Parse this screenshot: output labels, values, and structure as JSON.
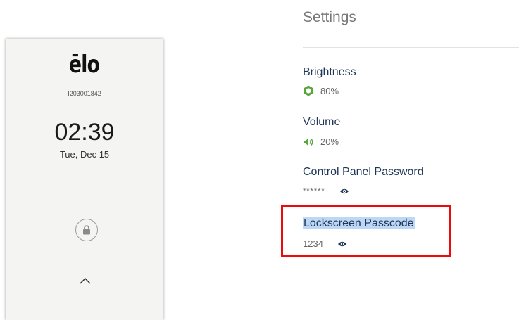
{
  "device": {
    "logo": "ēlo",
    "serial": "I203001842",
    "time": "02:39",
    "date": "Tue, Dec 15"
  },
  "settings": {
    "title": "Settings",
    "brightness": {
      "label": "Brightness",
      "value": "80%"
    },
    "volume": {
      "label": "Volume",
      "value": "20%"
    },
    "control_panel_password": {
      "label": "Control Panel Password",
      "value": "******"
    },
    "lockscreen_passcode": {
      "label": "Lockscreen Passcode",
      "value": "1234"
    }
  },
  "colors": {
    "accent_green": "#57a639",
    "highlight_red": "#ee0a0a",
    "label_navy": "#1d3557",
    "selection": "#bcd8f6"
  },
  "icons": [
    "brightness-icon",
    "volume-icon",
    "eye-icon",
    "lock-icon",
    "chevron-up-icon"
  ]
}
